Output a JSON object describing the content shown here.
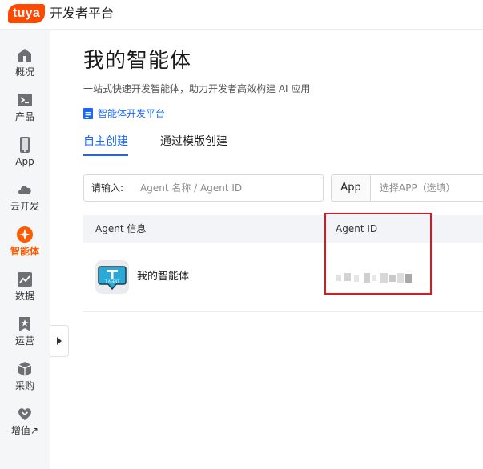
{
  "header": {
    "logo_text": "tuya",
    "title": "开发者平台"
  },
  "sidebar": {
    "items": [
      {
        "label": "概况",
        "icon": "home-icon",
        "active": false
      },
      {
        "label": "产品",
        "icon": "terminal-icon",
        "active": false
      },
      {
        "label": "App",
        "icon": "phone-icon",
        "active": false
      },
      {
        "label": "云开发",
        "icon": "cloud-icon",
        "active": false
      },
      {
        "label": "智能体",
        "icon": "spark-icon",
        "active": true
      },
      {
        "label": "数据",
        "icon": "chart-icon",
        "active": false
      },
      {
        "label": "运营",
        "icon": "star-bookmark-icon",
        "active": false
      },
      {
        "label": "采购",
        "icon": "box-icon",
        "active": false
      },
      {
        "label": "增值↗",
        "icon": "heart-chevron-icon",
        "active": false
      }
    ]
  },
  "main": {
    "title": "我的智能体",
    "subtitle": "一站式快速开发智能体，助力开发者高效构建 AI 应用",
    "platform_link": "智能体开发平台",
    "tabs": [
      {
        "label": "自主创建",
        "active": true
      },
      {
        "label": "通过模版创建",
        "active": false
      }
    ],
    "filter": {
      "search_label": "请输入:",
      "search_placeholder": "Agent 名称 / Agent ID",
      "app_prefix": "App",
      "app_placeholder": "选择APP（选填）"
    },
    "table": {
      "headers": [
        "Agent 信息",
        "Agent ID"
      ],
      "rows": [
        {
          "name": "我的智能体",
          "avatar_text": "T AGENT",
          "agent_id": ""
        }
      ]
    }
  },
  "colors": {
    "brand": "#ff4800",
    "accent_blue": "#1a66ff",
    "active_nav": "#ff5a00",
    "highlight_red": "#e1161c"
  }
}
